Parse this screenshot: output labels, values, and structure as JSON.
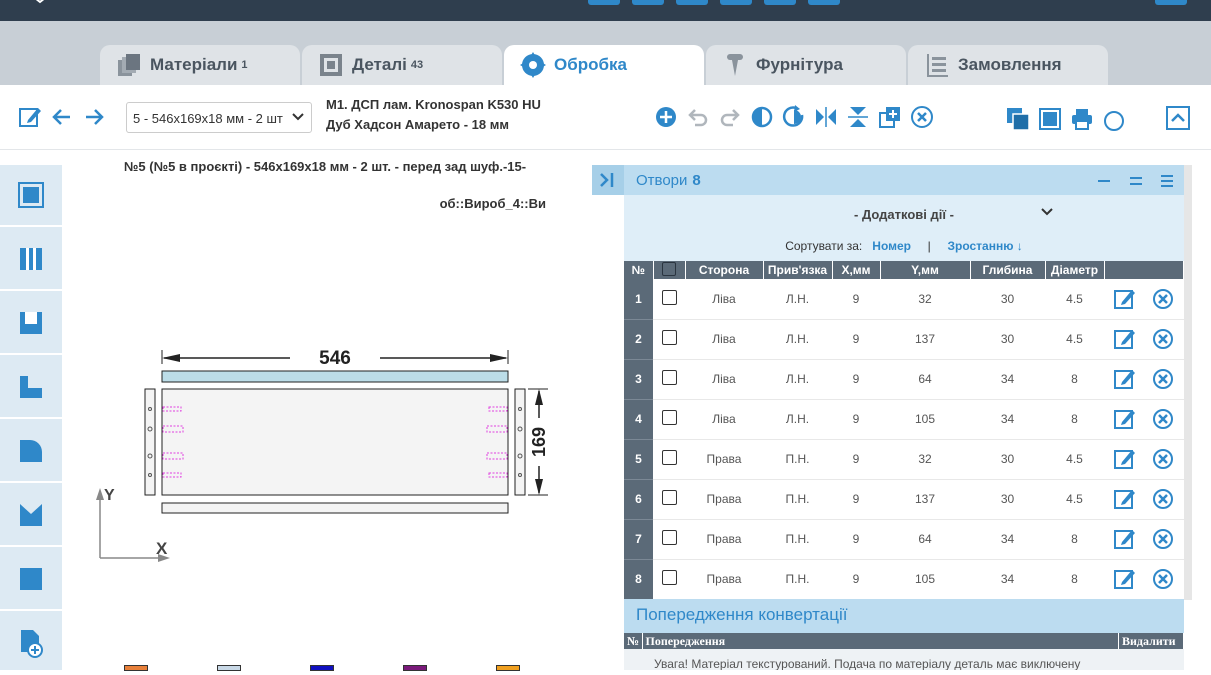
{
  "tabs": [
    {
      "label": "Матеріали",
      "badge": "1",
      "icon": "sheets-icon"
    },
    {
      "label": "Деталі",
      "badge": "43",
      "icon": "parts-icon"
    },
    {
      "label": "Обробка",
      "badge": "",
      "icon": "saw-blade-icon"
    },
    {
      "label": "Фурнітура",
      "badge": "",
      "icon": "screw-icon"
    },
    {
      "label": "Замовлення",
      "badge": "",
      "icon": "order-list-icon"
    }
  ],
  "toolbar": {
    "part_select_value": "5 - 546х169х18 мм - 2 шт",
    "material_line1": "М1. ДСП лам. Kronospan K530 HU",
    "material_line2": "Дуб Хадсон Амарето - 18 мм"
  },
  "drawing": {
    "title": "№5 (№5 в проєкті) - 546x169x18 мм - 2 шт. - перед зад шуф.-15-",
    "subtitle": "об::Вироб_4::Ви",
    "width_label": "546",
    "height_label": "169",
    "axis_x": "X",
    "axis_y": "Y"
  },
  "holes_panel": {
    "title": "Отвори",
    "count": "8",
    "actions_label": "- Додаткові дії -",
    "sort_prefix": "Сортувати за:",
    "sort_field": "Номер",
    "sort_separator": "|",
    "sort_order": "Зростанню ↓",
    "columns": [
      "№",
      "",
      "Сторона",
      "Прив'язка",
      "X,мм",
      "Y,мм",
      "Глибина",
      "Діаметр",
      ""
    ],
    "rows": [
      {
        "n": "1",
        "side": "Ліва",
        "bind": "Л.Н.",
        "x": "9",
        "y": "32",
        "depth": "30",
        "diam": "4.5"
      },
      {
        "n": "2",
        "side": "Ліва",
        "bind": "Л.Н.",
        "x": "9",
        "y": "137",
        "depth": "30",
        "diam": "4.5"
      },
      {
        "n": "3",
        "side": "Ліва",
        "bind": "Л.Н.",
        "x": "9",
        "y": "64",
        "depth": "34",
        "diam": "8"
      },
      {
        "n": "4",
        "side": "Ліва",
        "bind": "Л.Н.",
        "x": "9",
        "y": "105",
        "depth": "34",
        "diam": "8"
      },
      {
        "n": "5",
        "side": "Права",
        "bind": "П.Н.",
        "x": "9",
        "y": "32",
        "depth": "30",
        "diam": "4.5"
      },
      {
        "n": "6",
        "side": "Права",
        "bind": "П.Н.",
        "x": "9",
        "y": "137",
        "depth": "30",
        "diam": "4.5"
      },
      {
        "n": "7",
        "side": "Права",
        "bind": "П.Н.",
        "x": "9",
        "y": "64",
        "depth": "34",
        "diam": "8"
      },
      {
        "n": "8",
        "side": "Права",
        "bind": "П.Н.",
        "x": "9",
        "y": "105",
        "depth": "34",
        "diam": "8"
      }
    ]
  },
  "warnings": {
    "title": "Попередження конвертації",
    "col_num": "№",
    "col_text": "Попередження",
    "col_delete": "Видалити",
    "text": "Увага! Матеріал текстурований. Подача по матеріалу деталь має виключену"
  },
  "colors": {
    "accent": "#2f88c9",
    "topbar": "#2f3e4e",
    "panel_head": "#bcdcf0",
    "table_head": "#5b6a78",
    "hole_marks": "#e040e0",
    "swatches": [
      "#e8803a",
      "#c8d8e6",
      "#1010c0",
      "#7a1a7a",
      "#f0a020"
    ]
  }
}
